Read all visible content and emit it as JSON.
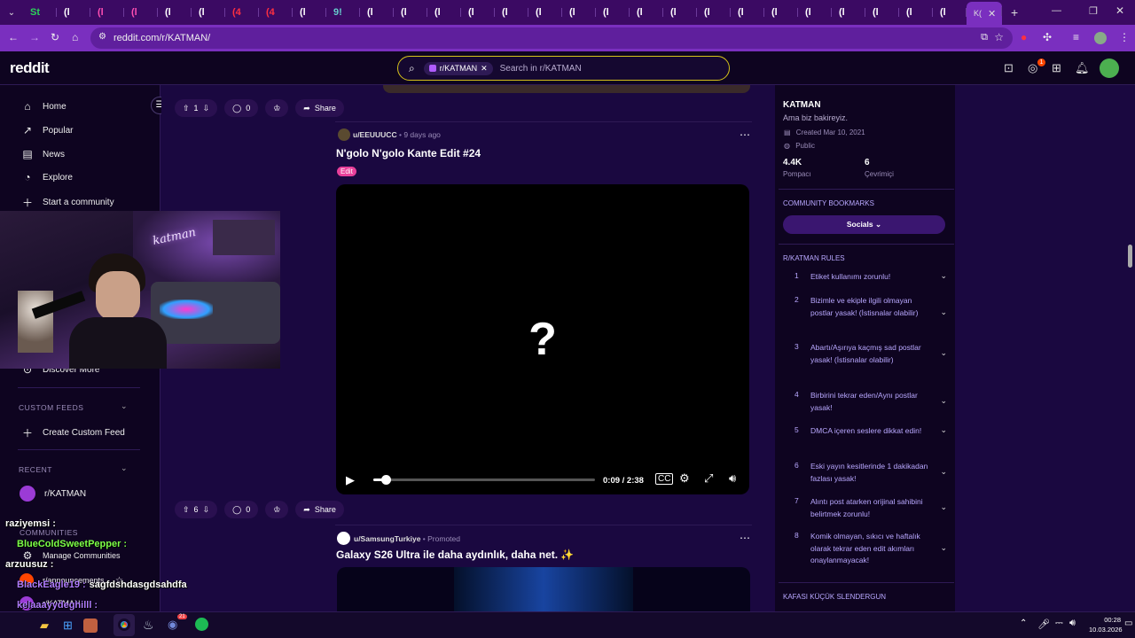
{
  "browser": {
    "tabs": [
      {
        "icon": "St",
        "color": "#2bd35a"
      },
      {
        "icon": "(l",
        "color": "#fff"
      },
      {
        "icon": "(l",
        "color": "#ff4fb3"
      },
      {
        "icon": "(l",
        "color": "#ff4fb3"
      },
      {
        "icon": "(l",
        "color": "#fff"
      },
      {
        "icon": "(l",
        "color": "#fff"
      },
      {
        "icon": "(4",
        "color": "#ff3040"
      },
      {
        "icon": "(4",
        "color": "#ff3040"
      },
      {
        "icon": "(l",
        "color": "#fff"
      },
      {
        "icon": "9!",
        "color": "#6cc"
      },
      {
        "icon": "(l",
        "color": "#fff"
      },
      {
        "icon": "(l",
        "color": "#fff"
      },
      {
        "icon": "(l",
        "color": "#fff"
      },
      {
        "icon": "(l",
        "color": "#fff"
      },
      {
        "icon": "(l",
        "color": "#fff"
      },
      {
        "icon": "(l",
        "color": "#fff"
      },
      {
        "icon": "(l",
        "color": "#fff"
      },
      {
        "icon": "(l",
        "color": "#fff"
      },
      {
        "icon": "(l",
        "color": "#fff"
      },
      {
        "icon": "(l",
        "color": "#fff"
      },
      {
        "icon": "(l",
        "color": "#fff"
      },
      {
        "icon": "(l",
        "color": "#fff"
      },
      {
        "icon": "(l",
        "color": "#fff"
      },
      {
        "icon": "(l",
        "color": "#fff"
      },
      {
        "icon": "(l",
        "color": "#fff"
      },
      {
        "icon": "(l",
        "color": "#fff"
      },
      {
        "icon": "(l",
        "color": "#fff"
      },
      {
        "icon": "(l",
        "color": "#fff"
      }
    ],
    "active_tab": "K(",
    "url": "reddit.com/r/KATMAN/"
  },
  "header": {
    "logo": "reddit",
    "search_chip": "r/KATMAN",
    "search_placeholder": "Search in r/KATMAN",
    "notification_count": "1"
  },
  "sidebar": {
    "nav": [
      {
        "icon": "home-icon",
        "label": "Home"
      },
      {
        "icon": "popular-icon",
        "label": "Popular"
      },
      {
        "icon": "news-icon",
        "label": "News"
      },
      {
        "icon": "explore-icon",
        "label": "Explore"
      },
      {
        "icon": "plus-icon",
        "label": "Start a community"
      }
    ],
    "discover_more": "Discover More",
    "custom_feeds_heading": "CUSTOM FEEDS",
    "create_custom_feed": "Create Custom Feed",
    "recent_heading": "RECENT",
    "recent_item": "r/KATMAN",
    "communities_heading": "COMMUNITIES",
    "manage_communities": "Manage Communities",
    "announcements": "r/announcements",
    "katman_item": "r/KATMAN"
  },
  "main": {
    "post1": {
      "votes": "1",
      "comments": "0",
      "share": "Share"
    },
    "post2": {
      "author": "u/EEUUUCC",
      "time": "9 days ago",
      "title": "N'golo N'golo Kante Edit #24",
      "flair": "Edit",
      "video_placeholder": "?",
      "time_display": "0:09 / 2:38",
      "progress": 0.057,
      "votes": "6",
      "comments": "0",
      "share": "Share"
    },
    "post3": {
      "author": "u/SamsungTurkiye",
      "promoted": "Promoted",
      "title": "Galaxy S26 Ultra ile daha aydınlık, daha net. ✨"
    }
  },
  "right": {
    "name": "KATMAN",
    "tagline": "Ama biz bakireyiz.",
    "created": "Created Mar 10, 2021",
    "visibility": "Public",
    "members_count": "4.4K",
    "members_label": "Pompacı",
    "online_count": "6",
    "online_label": "Çevrimiçi",
    "bookmarks_heading": "COMMUNITY BOOKMARKS",
    "bookmark_button": "Socials",
    "rules_heading": "R/KATMAN RULES",
    "rules": [
      {
        "n": "1",
        "text": "Etiket kullanımı zorunlu!"
      },
      {
        "n": "2",
        "text": "Bizimle ve ekiple ilgili olmayan postlar yasak! (İstisnalar olabilir)"
      },
      {
        "n": "3",
        "text": "Abartı/Aşırıya kaçmış sad postlar yasak! (İstisnalar olabilir)"
      },
      {
        "n": "4",
        "text": "Birbirini tekrar eden/Aynı postlar yasak!"
      },
      {
        "n": "5",
        "text": "DMCA içeren seslere dikkat edin!"
      },
      {
        "n": "6",
        "text": "Eski yayın kesitlerinde 1 dakikadan fazlası yasak!"
      },
      {
        "n": "7",
        "text": "Alıntı post atarken orijinal sahibini belirtmek zorunlu!"
      },
      {
        "n": "8",
        "text": "Komik olmayan, sıkıcı ve haftalık olarak tekrar eden edit akımları onaylanmayacak!"
      }
    ],
    "bottom_heading": "KAFASI KÜÇÜK SLENDERGUN"
  },
  "overlay": {
    "webcam_sign": "katman",
    "chat": [
      {
        "user": "raziyemsi :",
        "msg": "",
        "color": "#fff"
      },
      {
        "user": "BlueColdSweetPepper :",
        "msg": "",
        "color": "#7dff4a"
      },
      {
        "user": "arzuusuz :",
        "msg": "",
        "color": "#fff"
      },
      {
        "user": "BlackEagle19 :",
        "msg": "sagfdshdasgdsahdfa",
        "color": "#b07cff"
      },
      {
        "user": "kelaaayydeghilll :",
        "msg": "",
        "color": "#b07cff"
      },
      {
        "user": "edaumran",
        "msg": "",
        "color": "#fff"
      }
    ]
  },
  "taskbar": {
    "time": "00:28",
    "date": "10.03.2026",
    "discord_badge": "21"
  }
}
